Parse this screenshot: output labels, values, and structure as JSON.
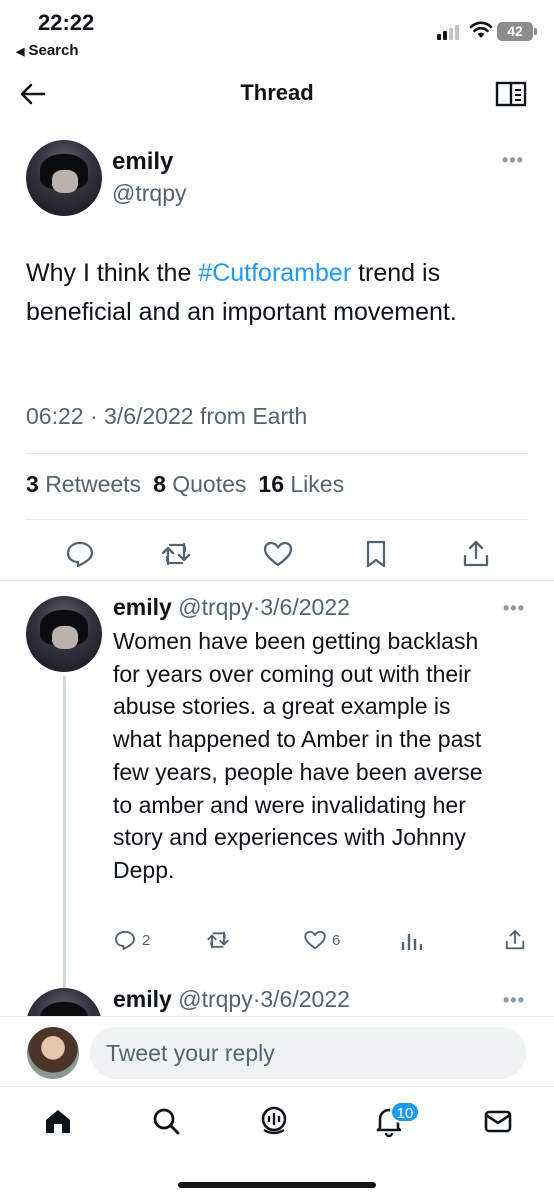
{
  "status_bar": {
    "time": "22:22",
    "back_label": "Search",
    "battery": "42"
  },
  "header": {
    "title": "Thread"
  },
  "main_tweet": {
    "name": "emily",
    "handle": "@trqpy",
    "text_before": "Why I think the ",
    "hashtag": "#Cutforamber",
    "text_after": " trend is beneficial and an important movement.",
    "time": "06:22",
    "date": "3/6/2022",
    "source": "from Earth",
    "separator": "·",
    "retweets_count": "3",
    "retweets_label": "Retweets",
    "quotes_count": "8",
    "quotes_label": "Quotes",
    "likes_count": "16",
    "likes_label": "Likes"
  },
  "reply": {
    "name": "emily",
    "handle": "@trqpy",
    "separator": "·",
    "date": "3/6/2022",
    "text": "Women have been getting backlash for years over coming out with their abuse stories. a great example is what happened to Amber in the past few years, people have been averse to amber and were invalidating her story and experiences with Johnny Depp.",
    "reply_count": "2",
    "like_count": "6"
  },
  "reply2": {
    "name": "emily",
    "handle": "@trqpy",
    "separator": "·",
    "date": "3/6/2022"
  },
  "compose": {
    "placeholder": "Tweet your reply"
  },
  "tabbar": {
    "notifications_badge": "10",
    "items": [
      "home-icon",
      "search-icon",
      "spaces-icon",
      "bell-icon",
      "mail-icon"
    ]
  },
  "colors": {
    "accent": "#1d9bf0",
    "text": "#0f1419",
    "secondary": "#536471"
  }
}
